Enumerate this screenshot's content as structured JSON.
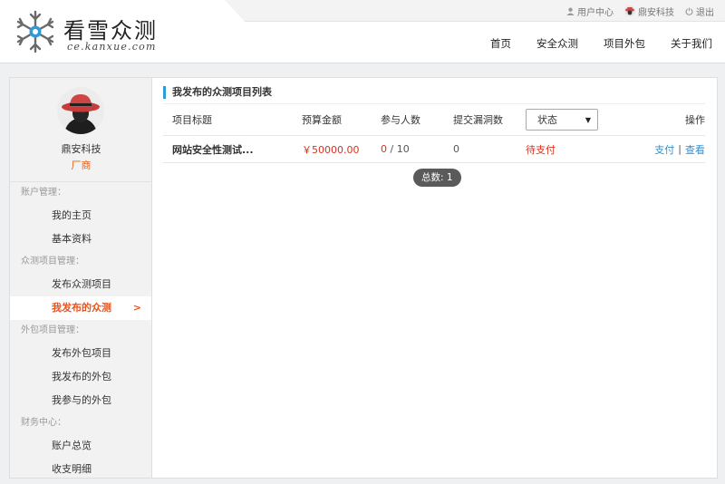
{
  "brand": {
    "title": "看雪众测",
    "subtitle": "ce.kanxue.com",
    "logo_icon": "snowflake-logo-icon"
  },
  "topbar": {
    "user_center": "用户中心",
    "username": "鼎安科技",
    "logout": "退出"
  },
  "nav": {
    "items": [
      "首页",
      "安全众测",
      "项目外包",
      "关于我们"
    ]
  },
  "profile": {
    "name": "鼎安科技",
    "role": "厂商",
    "avatar_icon": "red-hat-avatar-icon"
  },
  "menu": {
    "account_group": "账户管理：",
    "my_home": "我的主页",
    "basic_info": "基本资料",
    "crowdtest_group": "众测项目管理：",
    "publish_crowdtest": "发布众测项目",
    "my_published_crowdtest": "我发布的众测",
    "active_arrow": ">",
    "outsource_group": "外包项目管理：",
    "publish_outsource": "发布外包项目",
    "my_published_outsource": "我发布的外包",
    "my_joined_outsource": "我参与的外包",
    "finance_group": "财务中心：",
    "account_overview": "账户总览",
    "transactions": "收支明细"
  },
  "panel": {
    "title": "我发布的众测项目列表"
  },
  "table": {
    "headers": {
      "title": "项目标题",
      "budget": "预算金额",
      "participants": "参与人数",
      "bugs": "提交漏洞数",
      "status": "状态",
      "ops": "操作"
    },
    "rows": [
      {
        "title": "网站安全性测试...",
        "budget": "￥50000.00",
        "joined": "0",
        "total": "10",
        "bugs": "0",
        "status": "待支付",
        "pay": "支付",
        "view": "查看"
      }
    ]
  },
  "footer": {
    "total": "总数: 1"
  },
  "colors": {
    "accent_blue": "#2f9ad6",
    "active_orange": "#e8541e",
    "money_red": "#d9331f"
  }
}
